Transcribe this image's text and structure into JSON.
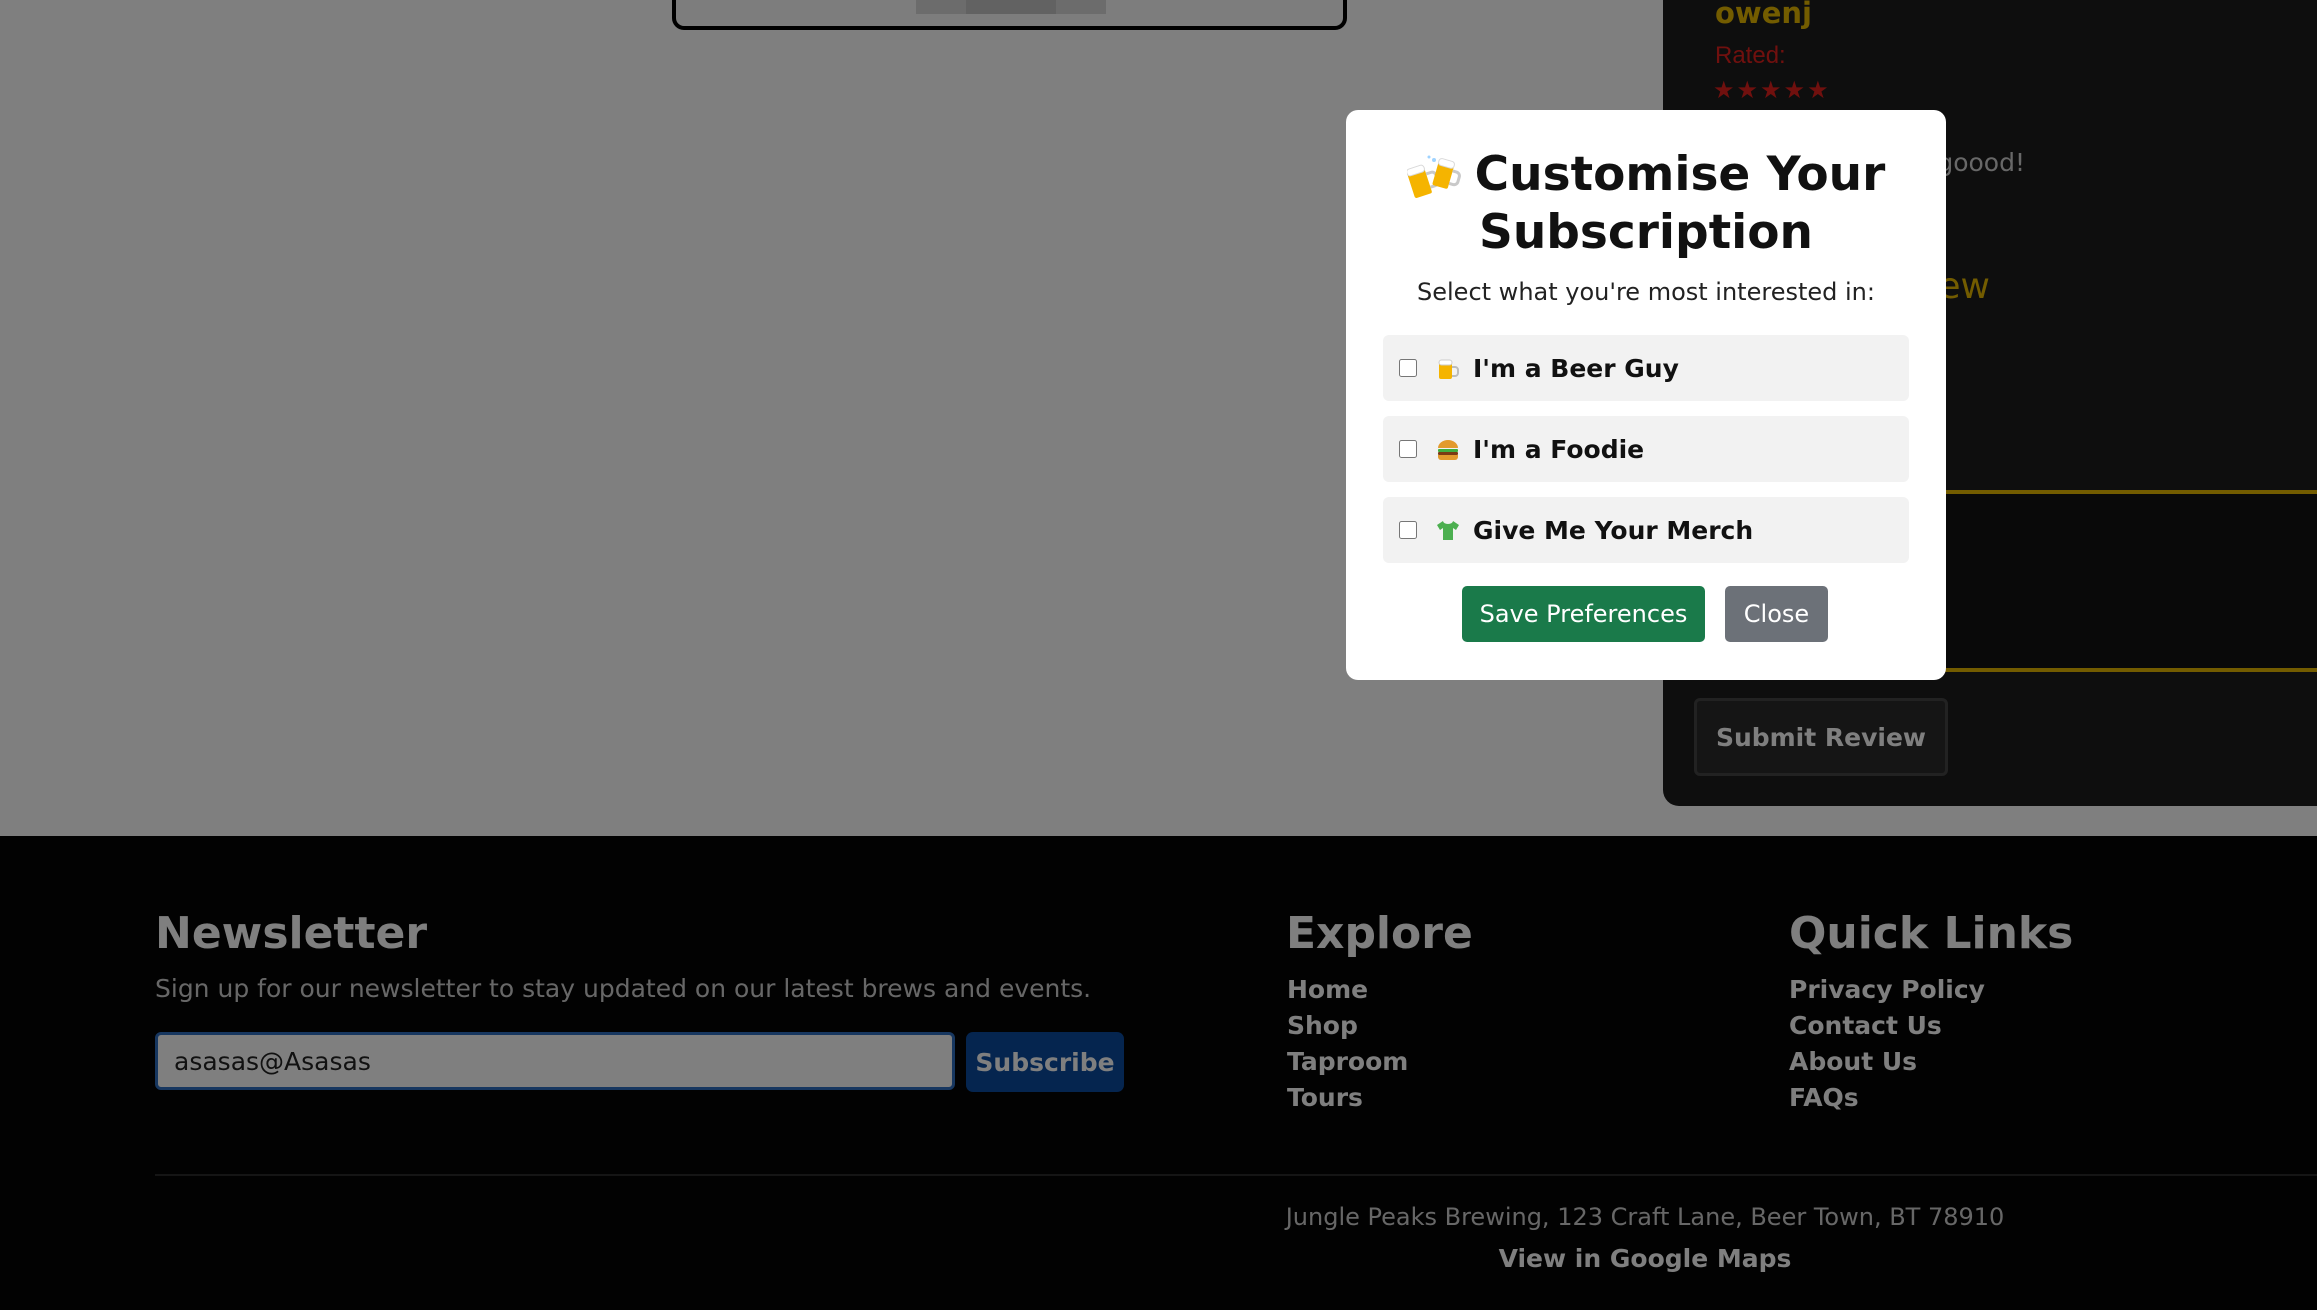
{
  "review": {
    "reviewer": "owenj",
    "rated_label": "Rated:",
    "stars": "★★★★★",
    "text_fragment": "goood!",
    "heading_fragment": "ew",
    "submit_label": "Submit Review"
  },
  "modal": {
    "title": "Customise Your Subscription",
    "subtitle": "Select what you're most interested in:",
    "options": [
      {
        "label": "I'm a Beer Guy",
        "icon": "beer-mug-icon",
        "checked": false
      },
      {
        "label": "I'm a Foodie",
        "icon": "burger-icon",
        "checked": false
      },
      {
        "label": "Give Me Your Merch",
        "icon": "tshirt-icon",
        "checked": false
      }
    ],
    "save_label": "Save Preferences",
    "close_label": "Close"
  },
  "footer": {
    "newsletter": {
      "title": "Newsletter",
      "description": "Sign up for our newsletter to stay updated on our latest brews and events.",
      "email_value": "asasas@Asasas",
      "subscribe_label": "Subscribe"
    },
    "explore": {
      "title": "Explore",
      "links": [
        "Home",
        "Shop",
        "Taproom",
        "Tours"
      ]
    },
    "quick_links": {
      "title": "Quick Links",
      "links": [
        "Privacy Policy",
        "Contact Us",
        "About Us",
        "FAQs"
      ]
    },
    "address": "Jungle Peaks Brewing, 123 Craft Lane, Beer Town, BT 78910",
    "maps_link": "View in Google Maps"
  },
  "colors": {
    "accent_gold": "#e6b800",
    "rating_red": "#e0201c",
    "save_green": "#1a7a4a",
    "close_gray": "#6c7178",
    "subscribe_blue": "#0a4a9e"
  }
}
